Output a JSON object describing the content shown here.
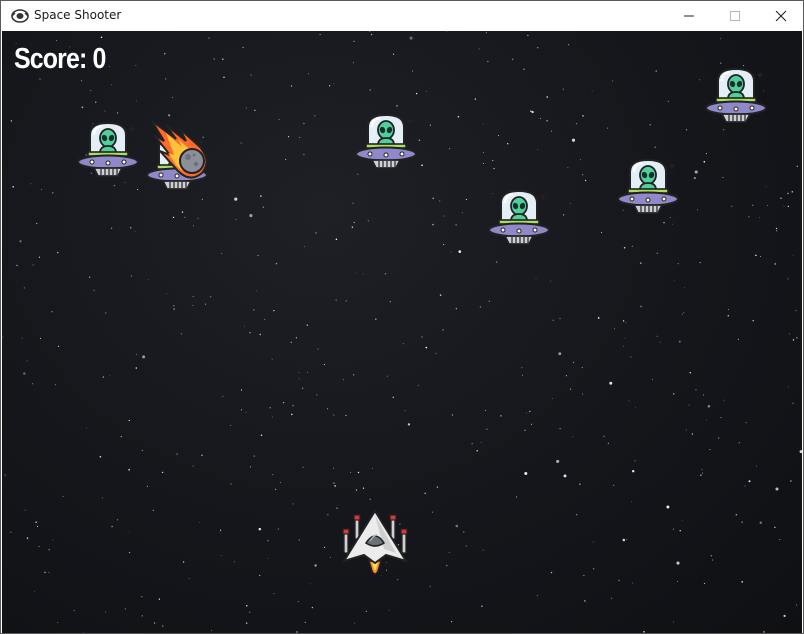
{
  "window": {
    "title": "Space Shooter"
  },
  "hud": {
    "score_label": "Score: 0"
  },
  "entities": {
    "player": "spaceship",
    "enemies": [
      "alien-ufo",
      "alien-ufo",
      "alien-ufo",
      "alien-ufo",
      "alien-ufo",
      "alien-ufo"
    ],
    "projectiles": [
      "meteor"
    ]
  },
  "colors": {
    "space_background": "#15171c",
    "ufo_dome": "#dbe9f3",
    "ufo_body": "#8f88c9",
    "alien_skin": "#4fcf9a",
    "meteor_fire": "#ff6a2b",
    "ship_hull": "#e6e6e6",
    "score_text": "#ffffff"
  }
}
